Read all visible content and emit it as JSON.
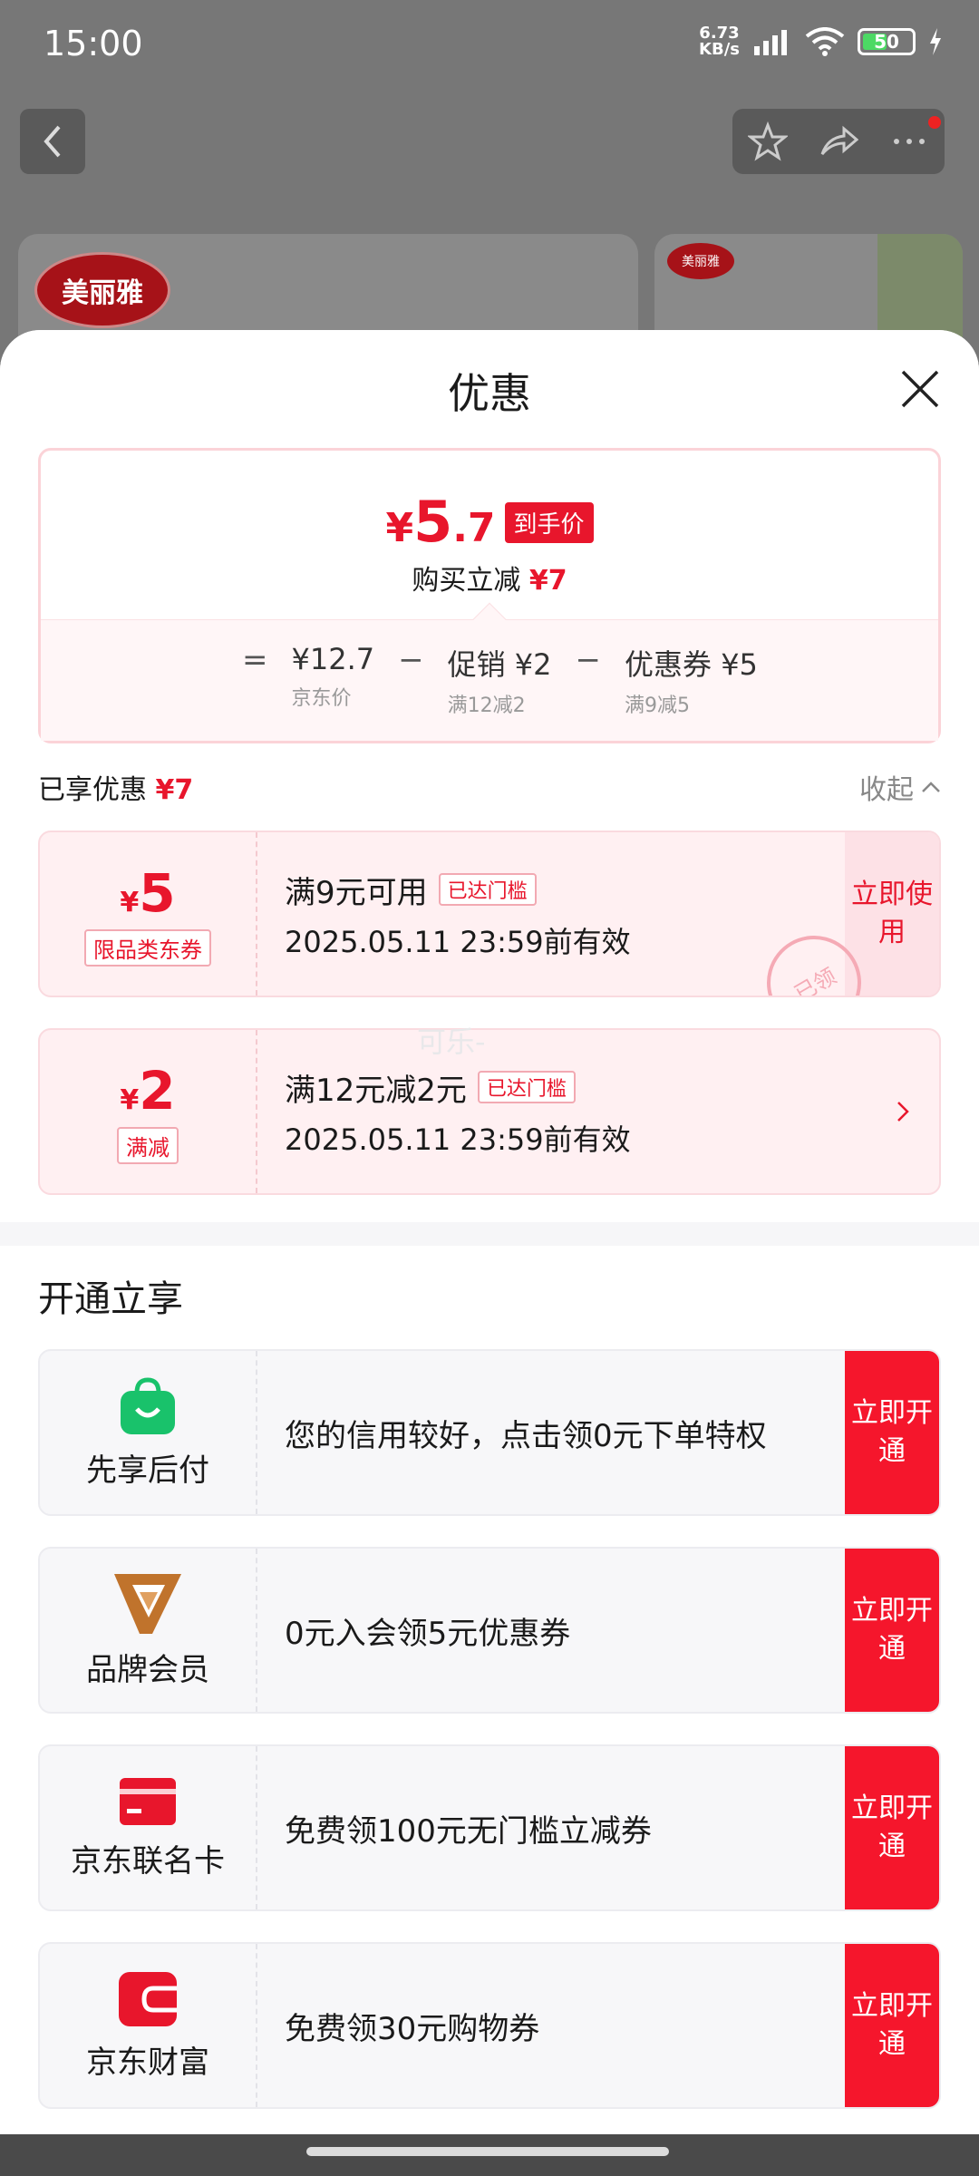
{
  "status_bar": {
    "time": "15:00",
    "net_speed_value": "6.73",
    "net_speed_unit": "KB/s",
    "battery": "50"
  },
  "background": {
    "logo_text": "美丽雅",
    "logo_text_small": "美丽雅"
  },
  "sheet": {
    "title": "优惠",
    "price": {
      "currency": "¥",
      "integer": "5",
      "decimal": ".7",
      "tag": "到手价"
    },
    "reduce": {
      "label": "购买立减",
      "amount": "¥7"
    },
    "formula": {
      "equals": "=",
      "op": "−",
      "items": [
        {
          "value": "¥12.7",
          "sub": "京东价"
        },
        {
          "value": "促销 ¥2",
          "sub": "满12减2"
        },
        {
          "value": "优惠券 ¥5",
          "sub": "满9减5"
        }
      ]
    },
    "enjoyed": {
      "label": "已享优惠",
      "amount": "¥7",
      "collapse": "收起"
    },
    "coupons": [
      {
        "currency": "¥",
        "amount": "5",
        "tag": "限品类东券",
        "condition": "满9元可用",
        "reached": "已达门槛",
        "validity": "2025.05.11 23:59前有效",
        "action": "立即使用",
        "stamp": "已领"
      },
      {
        "currency": "¥",
        "amount": "2",
        "tag": "满减",
        "condition": "满12元减2元",
        "reached": "已达门槛",
        "validity": "2025.05.11 23:59前有效"
      }
    ],
    "watermark": "可乐-"
  },
  "open_section": {
    "title": "开通立享",
    "items": [
      {
        "icon": "shopping-bag-icon",
        "name": "先享后付",
        "desc": "您的信用较好，点击领0元下单特权",
        "button": "立即开通",
        "color": "#19c26b"
      },
      {
        "icon": "v-logo-icon",
        "name": "品牌会员",
        "desc": "0元入会领5元优惠券",
        "button": "立即开通",
        "color": "#c0732c"
      },
      {
        "icon": "card-icon",
        "name": "京东联名卡",
        "desc": "免费领100元无门槛立减券",
        "button": "立即开通",
        "color": "#e8162c"
      },
      {
        "icon": "wallet-icon",
        "name": "京东财富",
        "desc": "免费领30元购物券",
        "button": "立即开通",
        "color": "#e8162c"
      }
    ]
  },
  "colors": {
    "accent": "#e8162c",
    "button": "#f5162c"
  }
}
